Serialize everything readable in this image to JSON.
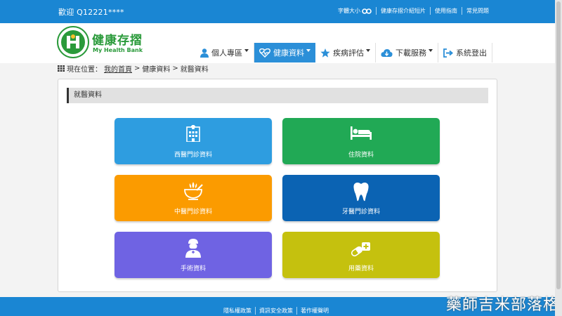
{
  "topbar": {
    "welcome": "歡迎 Q12221****",
    "links": [
      {
        "label": "字體大小"
      },
      {
        "label": "健康存摺介紹短片"
      },
      {
        "label": "使用指南"
      },
      {
        "label": "常見問題"
      }
    ]
  },
  "brand": {
    "name_cn": "健康存摺",
    "name_en": "My Health Bank"
  },
  "nav": {
    "items": [
      {
        "label": "個人專區",
        "icon": "user-icon"
      },
      {
        "label": "健康資料",
        "icon": "heartbeat-icon",
        "active": true
      },
      {
        "label": "疾病評估",
        "icon": "star-icon"
      },
      {
        "label": "下載服務",
        "icon": "cloud-download-icon"
      },
      {
        "label": "系統登出",
        "icon": "logout-icon"
      }
    ]
  },
  "breadcrumb": {
    "prefix": "現在位置：",
    "home": "我的首頁",
    "sep": ">",
    "level2": "健康資料",
    "level3": "就醫資料"
  },
  "panel": {
    "title": "就醫資料"
  },
  "tiles": [
    {
      "label": "西醫門診資料",
      "icon": "hospital-icon",
      "color": "#2e9de0"
    },
    {
      "label": "住院資料",
      "icon": "bed-icon",
      "color": "#21a955"
    },
    {
      "label": "中醫門診資料",
      "icon": "herb-mortar-icon",
      "color": "#fb9b00"
    },
    {
      "label": "牙醫門診資料",
      "icon": "tooth-icon",
      "color": "#0b63b3"
    },
    {
      "label": "手術資料",
      "icon": "surgeon-icon",
      "color": "#6f63e3"
    },
    {
      "label": "用藥資料",
      "icon": "pill-icon",
      "color": "#c5c10e"
    }
  ],
  "footer": {
    "links": [
      {
        "label": "隱私權政策"
      },
      {
        "label": "資訊安全政策"
      },
      {
        "label": "著作權聲明"
      }
    ]
  },
  "watermark": "藥師吉米部落格",
  "colors": {
    "topbar": "#1a86d3",
    "nav_active": "#2b8fd8",
    "brand_green": "#2a9a3a"
  }
}
